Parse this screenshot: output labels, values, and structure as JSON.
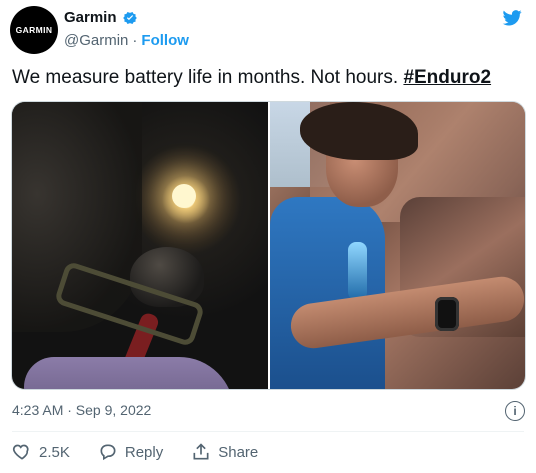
{
  "account": {
    "avatar_text": "GARMIN",
    "display_name": "Garmin",
    "handle": "@Garmin",
    "separator": "·",
    "follow": "Follow"
  },
  "tweet": {
    "text": "We measure battery life in months. Not hours.",
    "hashtag": "#Enduro2",
    "timestamp": "4:23 AM · Sep 9, 2022"
  },
  "actions": {
    "likes": "2.5K",
    "reply": "Reply",
    "share": "Share"
  },
  "icons": {
    "verified": "verified-badge-icon",
    "twitter": "twitter-bird-icon",
    "info": "info-icon",
    "like": "heart-icon",
    "reply": "reply-bubble-icon",
    "share": "share-icon"
  },
  "colors": {
    "accent": "#1d9bf0",
    "text": "#0f1419",
    "secondary": "#536471"
  }
}
